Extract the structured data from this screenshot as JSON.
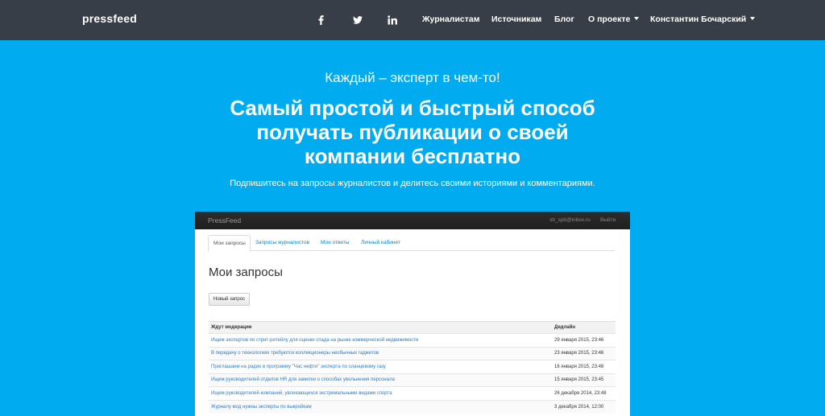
{
  "navbar": {
    "brand": "pressfeed",
    "social": [
      {
        "name": "facebook-icon",
        "glyph": "f"
      },
      {
        "name": "twitter-icon",
        "glyph": "twitter"
      },
      {
        "name": "linkedin-icon",
        "glyph": "in"
      }
    ],
    "links": {
      "journalists": "Журналистам",
      "sources": "Источникам",
      "blog": "Блог",
      "about": "О проекте",
      "user": "Константин Бочарский"
    }
  },
  "hero": {
    "tagline": "Каждый – эксперт в чем-то!",
    "title_line1": "Самый простой и быстрый способ",
    "title_line2": "получать публикации о своей",
    "title_line3": "компании бесплатно",
    "subtitle": "Подпишитесь на запросы журналистов и делитесь своими историями и комментариями."
  },
  "app": {
    "brand": "PressFeed",
    "email": "sb_spb@inbox.ru",
    "logout": "Выйти",
    "tabs": [
      "Мои запросы",
      "Запросы журналистов",
      "Мои ответы",
      "Личный кабинет"
    ],
    "page_title": "Мои запросы",
    "new_request": "Новый запрос",
    "table": {
      "headers": [
        "Ждут модерации",
        "Дедлайн"
      ],
      "rows": [
        {
          "title": "Ищем экспертов по стрит-ритейлу для оценки спада на рынке коммерческой недвижимости",
          "deadline": "29 января 2015, 23:46"
        },
        {
          "title": "В передачу о технологиях требуются коллекционеры необычных гаджетов",
          "deadline": "23 января 2015, 23:46"
        },
        {
          "title": "Приглашаем на радио в программу \"Час нефти\" эксперта по сланцевому газу",
          "deadline": "16 января 2015, 23:48"
        },
        {
          "title": "Ищем руководителей отделов HR для заметки о способах увольнения персонала",
          "deadline": "15 января 2015, 23:45"
        },
        {
          "title": "Ищем руководителей компаний, увлекающихся экстремальными видами спорта",
          "deadline": "26 декабря 2014, 23:48"
        },
        {
          "title": "Журналу мод нужны эксперты по выкройкам",
          "deadline": "3 декабря 2014, 12:00"
        }
      ]
    }
  }
}
